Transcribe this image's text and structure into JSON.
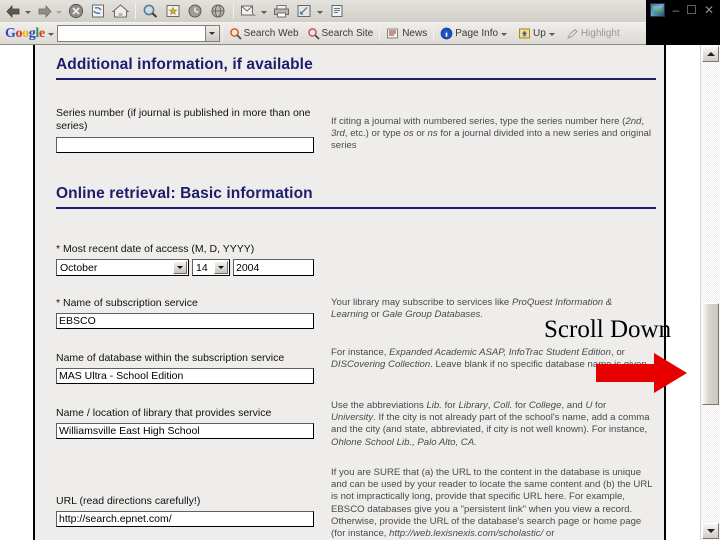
{
  "browser": {
    "nav_buttons": [
      {
        "name": "back-button",
        "icon": "back-arrow-icon",
        "label": "Back"
      },
      {
        "name": "forward-button",
        "icon": "forward-arrow-icon",
        "label": "Forward"
      },
      {
        "name": "stop-button",
        "icon": "stop-icon",
        "label": "Stop"
      },
      {
        "name": "refresh-button",
        "icon": "refresh-icon",
        "label": "Refresh"
      },
      {
        "name": "home-button",
        "icon": "home-icon",
        "label": "Home"
      },
      {
        "name": "search-button",
        "icon": "search-icon",
        "label": "Search"
      },
      {
        "name": "favorites-button",
        "icon": "favorites-star-icon",
        "label": "Favorites"
      },
      {
        "name": "history-button",
        "icon": "history-clock-icon",
        "label": "History"
      },
      {
        "name": "media-button",
        "icon": "media-globe-icon",
        "label": "Media"
      },
      {
        "name": "mail-button",
        "icon": "mail-icon",
        "label": "Mail"
      },
      {
        "name": "print-button",
        "icon": "printer-icon",
        "label": "Print"
      },
      {
        "name": "edit-button",
        "icon": "edit-page-icon",
        "label": "Edit"
      },
      {
        "name": "discuss-button",
        "icon": "discuss-icon",
        "label": "Discuss"
      }
    ],
    "window_controls": {
      "minimize": "–",
      "maximize": "☐",
      "close": "✕"
    }
  },
  "google_toolbar": {
    "logo_letters": [
      "G",
      "o",
      "o",
      "g",
      "l",
      "e"
    ],
    "search_value": "",
    "search_placeholder": "",
    "buttons": [
      {
        "label": "Search Web",
        "icon": "google-magnifier-icon",
        "has_caret": false
      },
      {
        "label": "Search Site",
        "icon": "google-site-magnifier-icon",
        "has_caret": false
      },
      {
        "label": "News",
        "icon": "news-icon",
        "has_caret": false
      },
      {
        "label": "Page Info",
        "icon": "page-info-icon",
        "has_caret": true
      },
      {
        "label": "Up",
        "icon": "up-folder-icon",
        "has_caret": true
      },
      {
        "label": "Highlight",
        "icon": "highlight-pen-icon",
        "has_caret": false
      }
    ]
  },
  "form": {
    "sections": [
      {
        "heading": "Additional information, if available",
        "fields": [
          {
            "label": "Series number (if journal is published in more than one series)",
            "value": "",
            "help": "If citing a journal with numbered series, type the series number here (2nd, 3rd, etc.) or type os or ns for a journal divided into a new series and original series",
            "help_italic_fragments": [
              "2nd",
              "3rd",
              "os",
              "ns"
            ]
          }
        ]
      },
      {
        "heading": "Online retrieval: Basic information",
        "fields": [
          {
            "label": "* Most recent date of access (M, D, YYYY)",
            "month_value": "October",
            "day_value": "14",
            "year_value": "2004",
            "help": ""
          },
          {
            "label": "* Name of subscription service",
            "value": "EBSCO",
            "help": "Your library may subscribe to services like ProQuest Information & Learning or Gale Group Databases."
          },
          {
            "label": "Name of database within the subscription service",
            "value": "MAS Ultra - School Edition",
            "help": "For instance, Expanded Academic ASAP, InfoTrac Student Edition, or DISCovering Collection. Leave blank if no specific database name is given."
          },
          {
            "label": "Name / location of library that provides service",
            "value": "Williamsville East High School",
            "help": "Use the abbreviations Lib. for Library, Coll. for College, and U for University. If the city is not already part of the school's name, add a comma and the city (and state, abbreviated, if city is not well known). For instance, Ohlone School Lib., Palo Alto, CA."
          },
          {
            "label": "URL (read directions carefully!)",
            "value": "http://search.epnet.com/",
            "help": "If you are SURE that (a) the URL to the content in the database is unique and can be used by your reader to locate the same content and (b) the URL is not impractically long, provide that specific URL here. For example, EBSCO databases give you a \"persistent link\" when you view a record. Otherwise, provide the URL of the database's search page or home page (for instance, http://web.lexisnexis.com/scholastic/ or"
          }
        ]
      }
    ]
  },
  "annotation": {
    "label": "Scroll Down",
    "arrow_color": "#e60000",
    "label_color": "#000000"
  },
  "scrollbar": {
    "up_arrow": "▲",
    "down_arrow": "▼",
    "thumb_position_percent": 52
  },
  "colors": {
    "heading_blue": "#1d1d6b",
    "page_background": "#eeedeb",
    "chrome_background": "#d6d3ce",
    "accent_red": "#e60000"
  }
}
